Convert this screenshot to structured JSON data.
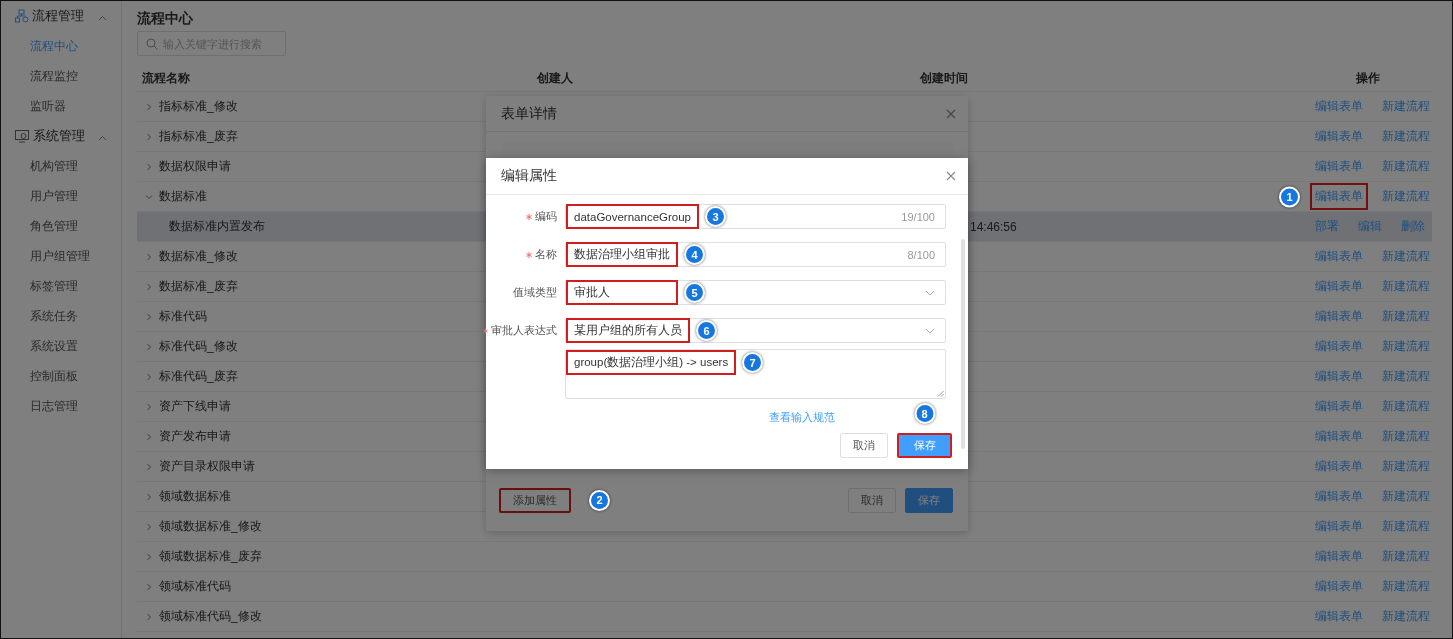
{
  "sidebar": {
    "groups": [
      {
        "title": "流程管理",
        "expanded": true,
        "items": [
          {
            "label": "流程中心",
            "selected": true
          },
          {
            "label": "流程监控",
            "selected": false
          },
          {
            "label": "监听器",
            "selected": false
          }
        ]
      },
      {
        "title": "系统管理",
        "expanded": true,
        "items": [
          {
            "label": "机构管理",
            "selected": false
          },
          {
            "label": "用户管理",
            "selected": false
          },
          {
            "label": "角色管理",
            "selected": false
          },
          {
            "label": "用户组管理",
            "selected": false
          },
          {
            "label": "标签管理",
            "selected": false
          },
          {
            "label": "系统任务",
            "selected": false
          },
          {
            "label": "系统设置",
            "selected": false
          },
          {
            "label": "控制面板",
            "selected": false
          },
          {
            "label": "日志管理",
            "selected": false
          }
        ]
      }
    ]
  },
  "page": {
    "title": "流程中心",
    "search": {
      "placeholder": "输入关键字进行搜索"
    },
    "table": {
      "columns": [
        "流程名称",
        "创建人",
        "创建时间",
        "操作"
      ],
      "rows": [
        {
          "name": "指标标准_修改",
          "expanded": false,
          "actions": [
            {
              "label": "编辑表单",
              "highlighted": false
            },
            {
              "label": "新建流程",
              "highlighted": false
            }
          ]
        },
        {
          "name": "指标标准_废弃",
          "expanded": false,
          "actions": [
            {
              "label": "编辑表单",
              "highlighted": false
            },
            {
              "label": "新建流程",
              "highlighted": false
            }
          ]
        },
        {
          "name": "数据权限申请",
          "expanded": false,
          "actions": [
            {
              "label": "编辑表单",
              "highlighted": false
            },
            {
              "label": "新建流程",
              "highlighted": false
            }
          ]
        },
        {
          "name": "数据标准",
          "expanded": true,
          "actions": [
            {
              "label": "编辑表单",
              "highlighted": true,
              "badge": "1"
            },
            {
              "label": "新建流程",
              "highlighted": false
            }
          ],
          "children": [
            {
              "name": "数据标准内置发布",
              "selected": true,
              "created_time": "14:46:56",
              "actions": [
                {
                  "label": "部署",
                  "highlighted": false
                },
                {
                  "label": "编辑",
                  "highlighted": false
                },
                {
                  "label": "删除",
                  "highlighted": false
                }
              ]
            }
          ]
        },
        {
          "name": "数据标准_修改",
          "expanded": false,
          "actions": [
            {
              "label": "编辑表单",
              "highlighted": false
            },
            {
              "label": "新建流程",
              "highlighted": false
            }
          ]
        },
        {
          "name": "数据标准_废弃",
          "expanded": false,
          "actions": [
            {
              "label": "编辑表单",
              "highlighted": false
            },
            {
              "label": "新建流程",
              "highlighted": false
            }
          ]
        },
        {
          "name": "标准代码",
          "expanded": false,
          "actions": [
            {
              "label": "编辑表单",
              "highlighted": false
            },
            {
              "label": "新建流程",
              "highlighted": false
            }
          ]
        },
        {
          "name": "标准代码_修改",
          "expanded": false,
          "actions": [
            {
              "label": "编辑表单",
              "highlighted": false
            },
            {
              "label": "新建流程",
              "highlighted": false
            }
          ]
        },
        {
          "name": "标准代码_废弃",
          "expanded": false,
          "actions": [
            {
              "label": "编辑表单",
              "highlighted": false
            },
            {
              "label": "新建流程",
              "highlighted": false
            }
          ]
        },
        {
          "name": "资产下线申请",
          "expanded": false,
          "actions": [
            {
              "label": "编辑表单",
              "highlighted": false
            },
            {
              "label": "新建流程",
              "highlighted": false
            }
          ]
        },
        {
          "name": "资产发布申请",
          "expanded": false,
          "actions": [
            {
              "label": "编辑表单",
              "highlighted": false
            },
            {
              "label": "新建流程",
              "highlighted": false
            }
          ]
        },
        {
          "name": "资产目录权限申请",
          "expanded": false,
          "actions": [
            {
              "label": "编辑表单",
              "highlighted": false
            },
            {
              "label": "新建流程",
              "highlighted": false
            }
          ]
        },
        {
          "name": "领域数据标准",
          "expanded": false,
          "actions": [
            {
              "label": "编辑表单",
              "highlighted": false
            },
            {
              "label": "新建流程",
              "highlighted": false
            }
          ]
        },
        {
          "name": "领域数据标准_修改",
          "expanded": false,
          "actions": [
            {
              "label": "编辑表单",
              "highlighted": false
            },
            {
              "label": "新建流程",
              "highlighted": false
            }
          ]
        },
        {
          "name": "领域数据标准_废弃",
          "expanded": false,
          "actions": [
            {
              "label": "编辑表单",
              "highlighted": false
            },
            {
              "label": "新建流程",
              "highlighted": false
            }
          ]
        },
        {
          "name": "领域标准代码",
          "expanded": false,
          "actions": [
            {
              "label": "编辑表单",
              "highlighted": false
            },
            {
              "label": "新建流程",
              "highlighted": false
            }
          ]
        },
        {
          "name": "领域标准代码_修改",
          "expanded": false,
          "actions": [
            {
              "label": "编辑表单",
              "highlighted": false
            },
            {
              "label": "新建流程",
              "highlighted": false
            }
          ]
        }
      ]
    }
  },
  "form_detail_dialog": {
    "title": "表单详情",
    "add_button": {
      "label": "添加属性",
      "highlighted": true,
      "badge": "2"
    },
    "buttons": [
      {
        "label": "取消",
        "kind": "default"
      },
      {
        "label": "保存",
        "kind": "primary"
      }
    ]
  },
  "edit_dialog": {
    "title": "编辑属性",
    "fields": [
      {
        "label": "编码",
        "required": true,
        "kind": "input",
        "value": "dataGovernanceGroup",
        "counter": "19/100",
        "highlighted": true,
        "badge": "3"
      },
      {
        "label": "名称",
        "required": true,
        "kind": "input",
        "value": "数据治理小组审批",
        "counter": "8/100",
        "highlighted": true,
        "badge": "4"
      },
      {
        "label": "值域类型",
        "required": false,
        "kind": "select",
        "value": "审批人",
        "highlighted": true,
        "badge": "5"
      },
      {
        "label": "审批人表达式",
        "required": true,
        "kind": "select",
        "value": "某用户组的所有人员",
        "highlighted": true,
        "badge": "6"
      },
      {
        "required": false,
        "kind": "textarea",
        "value": "group(数据治理小组) -> users",
        "highlighted": true,
        "badge": "7"
      }
    ],
    "help_link": "查看输入规范",
    "buttons": [
      {
        "label": "取消",
        "kind": "default",
        "highlighted": false
      },
      {
        "label": "保存",
        "kind": "primary",
        "highlighted": true,
        "badge": "8"
      }
    ]
  }
}
